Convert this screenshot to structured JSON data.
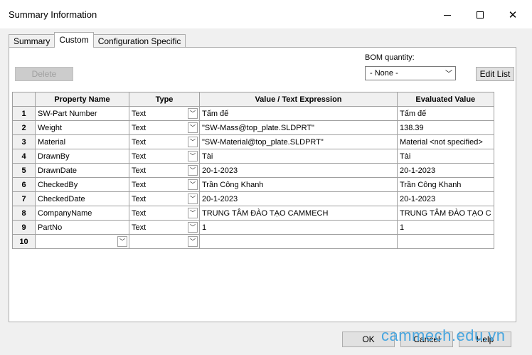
{
  "window": {
    "title": "Summary Information"
  },
  "tabs": [
    {
      "label": "Summary"
    },
    {
      "label": "Custom"
    },
    {
      "label": "Configuration Specific"
    }
  ],
  "toolbar": {
    "delete_label": "Delete",
    "bom_label": "BOM quantity:",
    "bom_value": "- None -",
    "edit_list_label": "Edit List"
  },
  "table": {
    "headers": [
      "Property Name",
      "Type",
      "Value / Text Expression",
      "Evaluated Value"
    ],
    "rows": [
      {
        "num": "1",
        "name": "SW-Part Number",
        "type": "Text",
        "value": "Tấm đế",
        "evaluated": "Tấm đế"
      },
      {
        "num": "2",
        "name": "Weight",
        "type": "Text",
        "value": "\"SW-Mass@top_plate.SLDPRT\"",
        "evaluated": "138.39"
      },
      {
        "num": "3",
        "name": "Material",
        "type": "Text",
        "value": "\"SW-Material@top_plate.SLDPRT\"",
        "evaluated": "Material <not specified>"
      },
      {
        "num": "4",
        "name": "DrawnBy",
        "type": "Text",
        "value": "Tài",
        "evaluated": "Tài"
      },
      {
        "num": "5",
        "name": "DrawnDate",
        "type": "Text",
        "value": "20-1-2023",
        "evaluated": "20-1-2023"
      },
      {
        "num": "6",
        "name": "CheckedBy",
        "type": "Text",
        "value": "Trần Công Khanh",
        "evaluated": "Trần Công Khanh"
      },
      {
        "num": "7",
        "name": "CheckedDate",
        "type": "Text",
        "value": "20-1-2023",
        "evaluated": "20-1-2023"
      },
      {
        "num": "8",
        "name": "CompanyName",
        "type": "Text",
        "value": "TRUNG TÂM ĐÀO TẠO CAMMECH",
        "evaluated": "TRUNG TÂM ĐÀO TẠO C"
      },
      {
        "num": "9",
        "name": "PartNo",
        "type": "Text",
        "value": "1",
        "evaluated": "1"
      },
      {
        "num": "10",
        "name": "",
        "type": "",
        "value": "",
        "evaluated": ""
      }
    ]
  },
  "footer": {
    "ok_label": "OK",
    "cancel_label": "Cancel",
    "help_label": "Help"
  },
  "watermark": "cammech.edu.vn"
}
